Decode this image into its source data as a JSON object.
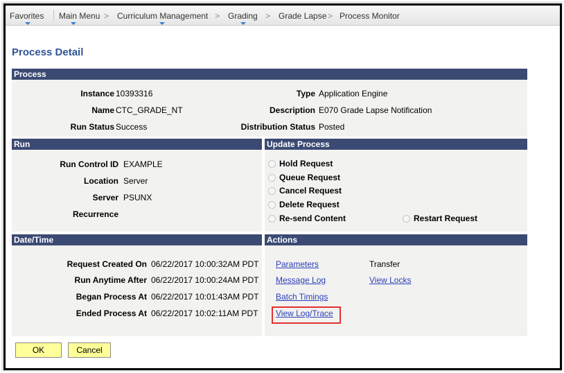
{
  "nav": {
    "favorites": "Favorites",
    "main_menu": "Main Menu",
    "curriculum": "Curriculum Management",
    "grading": "Grading",
    "grade_lapse": "Grade Lapse",
    "process_monitor": "Process Monitor",
    "separator": ">"
  },
  "page_title": "Process Detail",
  "process": {
    "header": "Process",
    "instance_label": "Instance",
    "instance_value": "10393316",
    "name_label": "Name",
    "name_value": "CTC_GRADE_NT",
    "run_status_label": "Run Status",
    "run_status_value": "Success",
    "type_label": "Type",
    "type_value": "Application Engine",
    "description_label": "Description",
    "description_value": "E070 Grade Lapse Notification",
    "dist_status_label": "Distribution Status",
    "dist_status_value": "Posted"
  },
  "run": {
    "header": "Run",
    "run_control_label": "Run Control ID",
    "run_control_value": "EXAMPLE",
    "location_label": "Location",
    "location_value": "Server",
    "server_label": "Server",
    "server_value": "PSUNX",
    "recurrence_label": "Recurrence"
  },
  "update_process": {
    "header": "Update Process",
    "hold": "Hold Request",
    "queue": "Queue Request",
    "cancel": "Cancel Request",
    "delete": "Delete Request",
    "resend": "Re-send Content",
    "restart": "Restart Request"
  },
  "datetime": {
    "header": "Date/Time",
    "created_label": "Request Created On",
    "created_value": "06/22/2017 10:00:32AM PDT",
    "anytime_label": "Run Anytime After",
    "anytime_value": "06/22/2017 10:00:24AM PDT",
    "began_label": "Began Process At",
    "began_value": "06/22/2017 10:01:43AM PDT",
    "ended_label": "Ended Process At",
    "ended_value": "06/22/2017 10:02:11AM PDT"
  },
  "actions": {
    "header": "Actions",
    "parameters": "Parameters",
    "transfer": "Transfer",
    "message_log": "Message Log",
    "view_locks": "View Locks",
    "batch_timings": "Batch Timings",
    "view_log_trace": "View Log/Trace"
  },
  "buttons": {
    "ok": "OK",
    "cancel": "Cancel"
  },
  "colors": {
    "section_header": "#3b4a73",
    "page_title": "#2f5496",
    "link": "#2c3fb8",
    "button_bg": "#ffff99",
    "highlight": "#e0302f"
  }
}
